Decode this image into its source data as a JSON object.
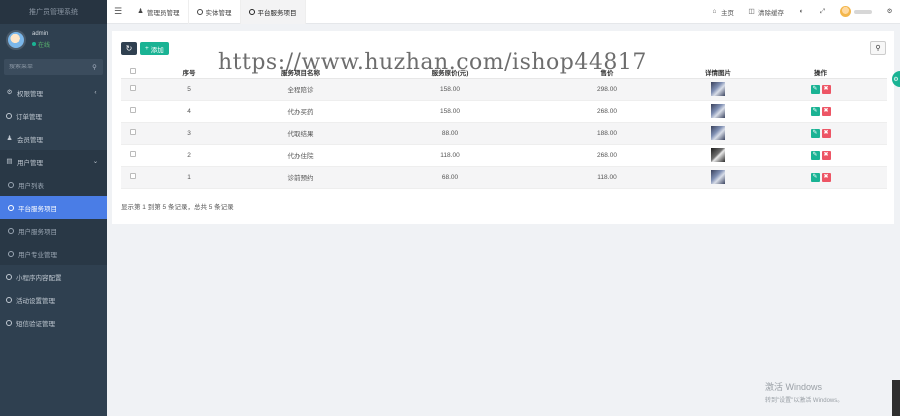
{
  "sidebar": {
    "brand": "推广员管理系统",
    "user": {
      "name": "admin",
      "status": "在线"
    },
    "search_placeholder": "搜索菜单",
    "items": [
      {
        "label": "权限管理",
        "icon": "gear-icon"
      },
      {
        "label": "订单管理",
        "icon": "circle-icon"
      },
      {
        "label": "会员管理",
        "icon": "user-icon"
      },
      {
        "label": "用户管理",
        "icon": "file-icon"
      }
    ],
    "submenu": [
      {
        "label": "用户列表"
      },
      {
        "label": "平台服务项目"
      },
      {
        "label": "用户服务项目"
      },
      {
        "label": "用户专业管理"
      }
    ],
    "items_after": [
      {
        "label": "小程序内容配置"
      },
      {
        "label": "活动设置管理"
      },
      {
        "label": "短信验证管理"
      }
    ]
  },
  "topbar": {
    "tabs": [
      {
        "label": "管理员管理"
      },
      {
        "label": "实体管理"
      },
      {
        "label": "平台服务项目"
      }
    ],
    "home": "主页",
    "clear_cache": "清除缓存",
    "username": "admin"
  },
  "toolbar": {
    "add_label": "添加"
  },
  "table": {
    "headers": [
      "序号",
      "服务项目名称",
      "服务原价(元)",
      "售价",
      "详情图片",
      "操作"
    ],
    "rows": [
      {
        "id": "5",
        "name": "全程陪诊",
        "price": "158.00",
        "sale": "298.00",
        "img": "t1"
      },
      {
        "id": "4",
        "name": "代办买药",
        "price": "158.00",
        "sale": "268.00",
        "img": "t1"
      },
      {
        "id": "3",
        "name": "代取结果",
        "price": "88.00",
        "sale": "188.00",
        "img": "t1"
      },
      {
        "id": "2",
        "name": "代办住院",
        "price": "118.00",
        "sale": "268.00",
        "img": "t2"
      },
      {
        "id": "1",
        "name": "诊前预约",
        "price": "68.00",
        "sale": "118.00",
        "img": "t1"
      }
    ]
  },
  "pager": "显示第 1 到第 5 条记录，总共 5 条记录",
  "watermark": "https://www.huzhan.com/ishop44817",
  "windows": {
    "line1": "激活 Windows",
    "line2": "转到\"设置\"以激活 Windows。"
  }
}
